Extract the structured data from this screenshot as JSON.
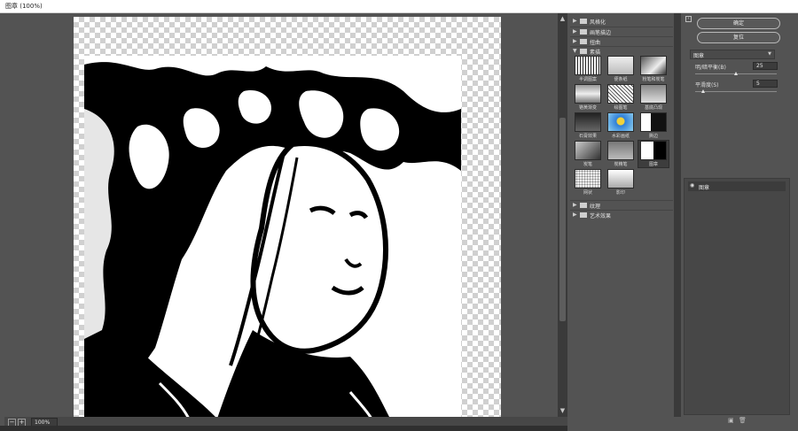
{
  "window": {
    "title": "图章 (100%)"
  },
  "canvas": {
    "zoom": "100%",
    "zoom_out_icon": "minus-square-icon",
    "zoom_in_icon": "plus-square-icon"
  },
  "gallery": {
    "categories_top": [
      {
        "label": "风格化",
        "expanded": false
      },
      {
        "label": "画笔描边",
        "expanded": false
      },
      {
        "label": "扭曲",
        "expanded": false
      },
      {
        "label": "素描",
        "expanded": true
      }
    ],
    "thumbnails": [
      {
        "label": "半调图案"
      },
      {
        "label": "便条纸"
      },
      {
        "label": "粉笔和炭笔"
      },
      {
        "label": "铬黄渐变"
      },
      {
        "label": "绘图笔"
      },
      {
        "label": "基底凸现"
      },
      {
        "label": "石膏效果"
      },
      {
        "label": "水彩画纸"
      },
      {
        "label": "撕边"
      },
      {
        "label": "炭笔"
      },
      {
        "label": "炭精笔"
      },
      {
        "label": "图章",
        "selected": true
      },
      {
        "label": "网状"
      },
      {
        "label": "影印"
      }
    ],
    "categories_bottom": [
      {
        "label": "纹理",
        "expanded": false
      },
      {
        "label": "艺术效果",
        "expanded": false
      }
    ]
  },
  "settings": {
    "ok_label": "确定",
    "reset_label": "复位",
    "filter_select": "图章",
    "params": [
      {
        "label": "明/暗平衡(B)",
        "value": "25",
        "fraction": 0.5
      },
      {
        "label": "平滑度(S)",
        "value": "5",
        "fraction": 0.1
      }
    ]
  },
  "layers": {
    "items": [
      {
        "label": "图章"
      }
    ]
  },
  "colors": {
    "panel": "#535353",
    "dark": "#3c3c3c",
    "accent_blue": "#2f7fd8"
  }
}
